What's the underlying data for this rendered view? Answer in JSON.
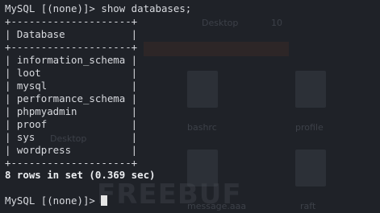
{
  "prompt": "MySQL [(none)]> ",
  "command": "show databases;",
  "table": {
    "border_top": "+--------------------+",
    "header_row": "| Database           |",
    "border_mid": "+--------------------+",
    "rows": [
      "| information_schema |",
      "| loot               |",
      "| mysql              |",
      "| performance_schema |",
      "| phpmyadmin         |",
      "| proof              |",
      "| sys                |",
      "| wordpress          |"
    ],
    "border_bottom": "+--------------------+"
  },
  "result": "8 rows in set (0.369 sec)",
  "prompt_after": "MySQL [(none)]> ",
  "background_desktop": {
    "labels": [
      "Desktop",
      "10",
      "bashrc",
      "profile",
      "Desktop",
      "message.aaa",
      "raft"
    ],
    "watermark": "FREEBUF"
  },
  "colors": {
    "background": "#1f2228",
    "text": "#d8dadf",
    "cursor": "#e6e6e6"
  }
}
